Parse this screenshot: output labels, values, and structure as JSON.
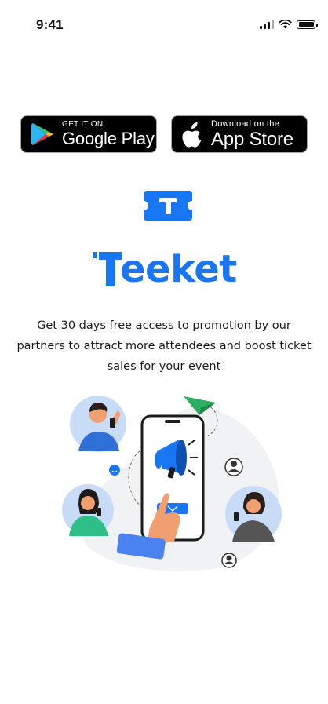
{
  "status_bar": {
    "time": "9:41"
  },
  "google_badge": {
    "small_text": "GET IT ON",
    "big_text": "Google Play",
    "icon": "google-play-icon"
  },
  "apple_badge": {
    "small_text": "Download on the",
    "big_text": "App Store",
    "icon": "apple-icon"
  },
  "logo": {
    "icon": "ticket-icon",
    "wordmark_rest": "eeket",
    "brand_color": "#1976f2"
  },
  "description": "Get  30 days free access to  promotion by our partners  to attract more attendees and boost ticket sales  for your  event",
  "illustration": {
    "icons": [
      "megaphone-icon",
      "paper-plane-icon",
      "smartphone-icon",
      "user-icon"
    ],
    "accent_color": "#1976f2",
    "skin_color": "#f0a070"
  }
}
